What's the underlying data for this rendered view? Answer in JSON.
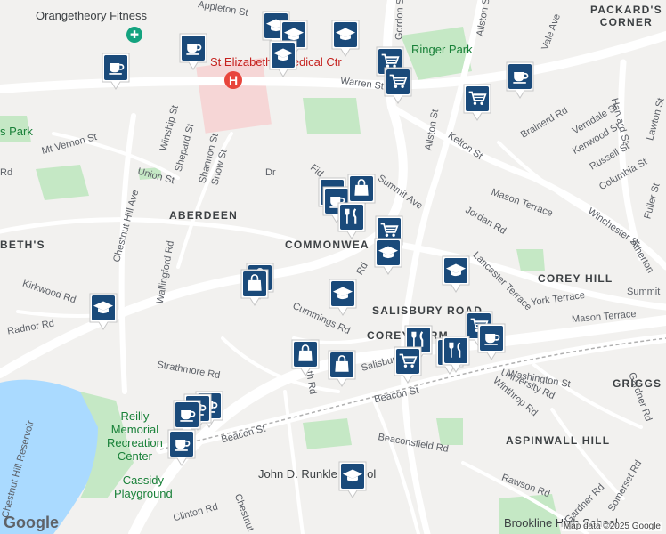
{
  "map": {
    "places": {
      "orangetheory": "Orangetheory Fitness",
      "hospital": "St Elizabeth's Medical Ctr",
      "ringer_park": "Ringer Park",
      "packards_corner": "PACKARD'S\nCORNER",
      "aberdeen": "ABERDEEN",
      "commonwealth": "COMMONWEA",
      "beths": "BETH'S",
      "corey_hill": "COREY HILL",
      "salisbury_road": "SALISBURY ROAD",
      "corey_farm": "COREY FARM",
      "griggs_park": "GRIGGS P",
      "aspinwall_hill": "ASPINWALL HILL",
      "reilly": "Reilly\nMemorial\nRecreation\nCenter",
      "cassidy": "Cassidy\nPlayground",
      "runkle": "John D. Runkle School",
      "brookline_high": "Brookline High School",
      "park_fragment": "s Park"
    },
    "streets": [
      "Warren St",
      "Kelton St",
      "Allston St",
      "Summit Ave",
      "Brainerd Rd",
      "Harvard St",
      "Verndale St",
      "Kenwood St",
      "Russell St",
      "Columbia St",
      "Lawton St",
      "Fuller St",
      "Winchester St",
      "Mason Terrace",
      "Jordan Rd",
      "Lancaster Terrace",
      "York Terrace",
      "Atherton",
      "Washington St",
      "Beacon St",
      "Gardner Rd",
      "Salisbury Rd",
      "Winthrop Rd",
      "University Rd",
      "Rawson Rd",
      "Somerset Rd",
      "Beaconsfield Rd",
      "Cummings Rd",
      "Strathmore Rd",
      "Clinton Rd",
      "Chestnut Hill Ave",
      "Wallingford Rd",
      "Kirkwood Rd",
      "Radnor Rd",
      "Mt Vernon St",
      "Union St",
      "Shepard St",
      "Shannon St",
      "Snow St",
      "Winship St",
      "Gordon St",
      "Appleton St",
      "Vale Ave",
      "Chestnut Hill Reservoir",
      "Fid",
      "Rd",
      "Dr",
      "th Rd",
      "Chestnut",
      "Summit"
    ],
    "pin_icons": [
      "cafe-icon",
      "school-icon",
      "shopping-cart-icon",
      "shopping-bag-icon",
      "restaurant-icon"
    ],
    "colors": {
      "pin": "#1a4a7a",
      "water": "#aadaff",
      "park": "#c5e8c5",
      "hospital": "#f6d6d6"
    }
  },
  "footer": {
    "logo": "Google",
    "attribution": "Map data ©2025 Google"
  }
}
